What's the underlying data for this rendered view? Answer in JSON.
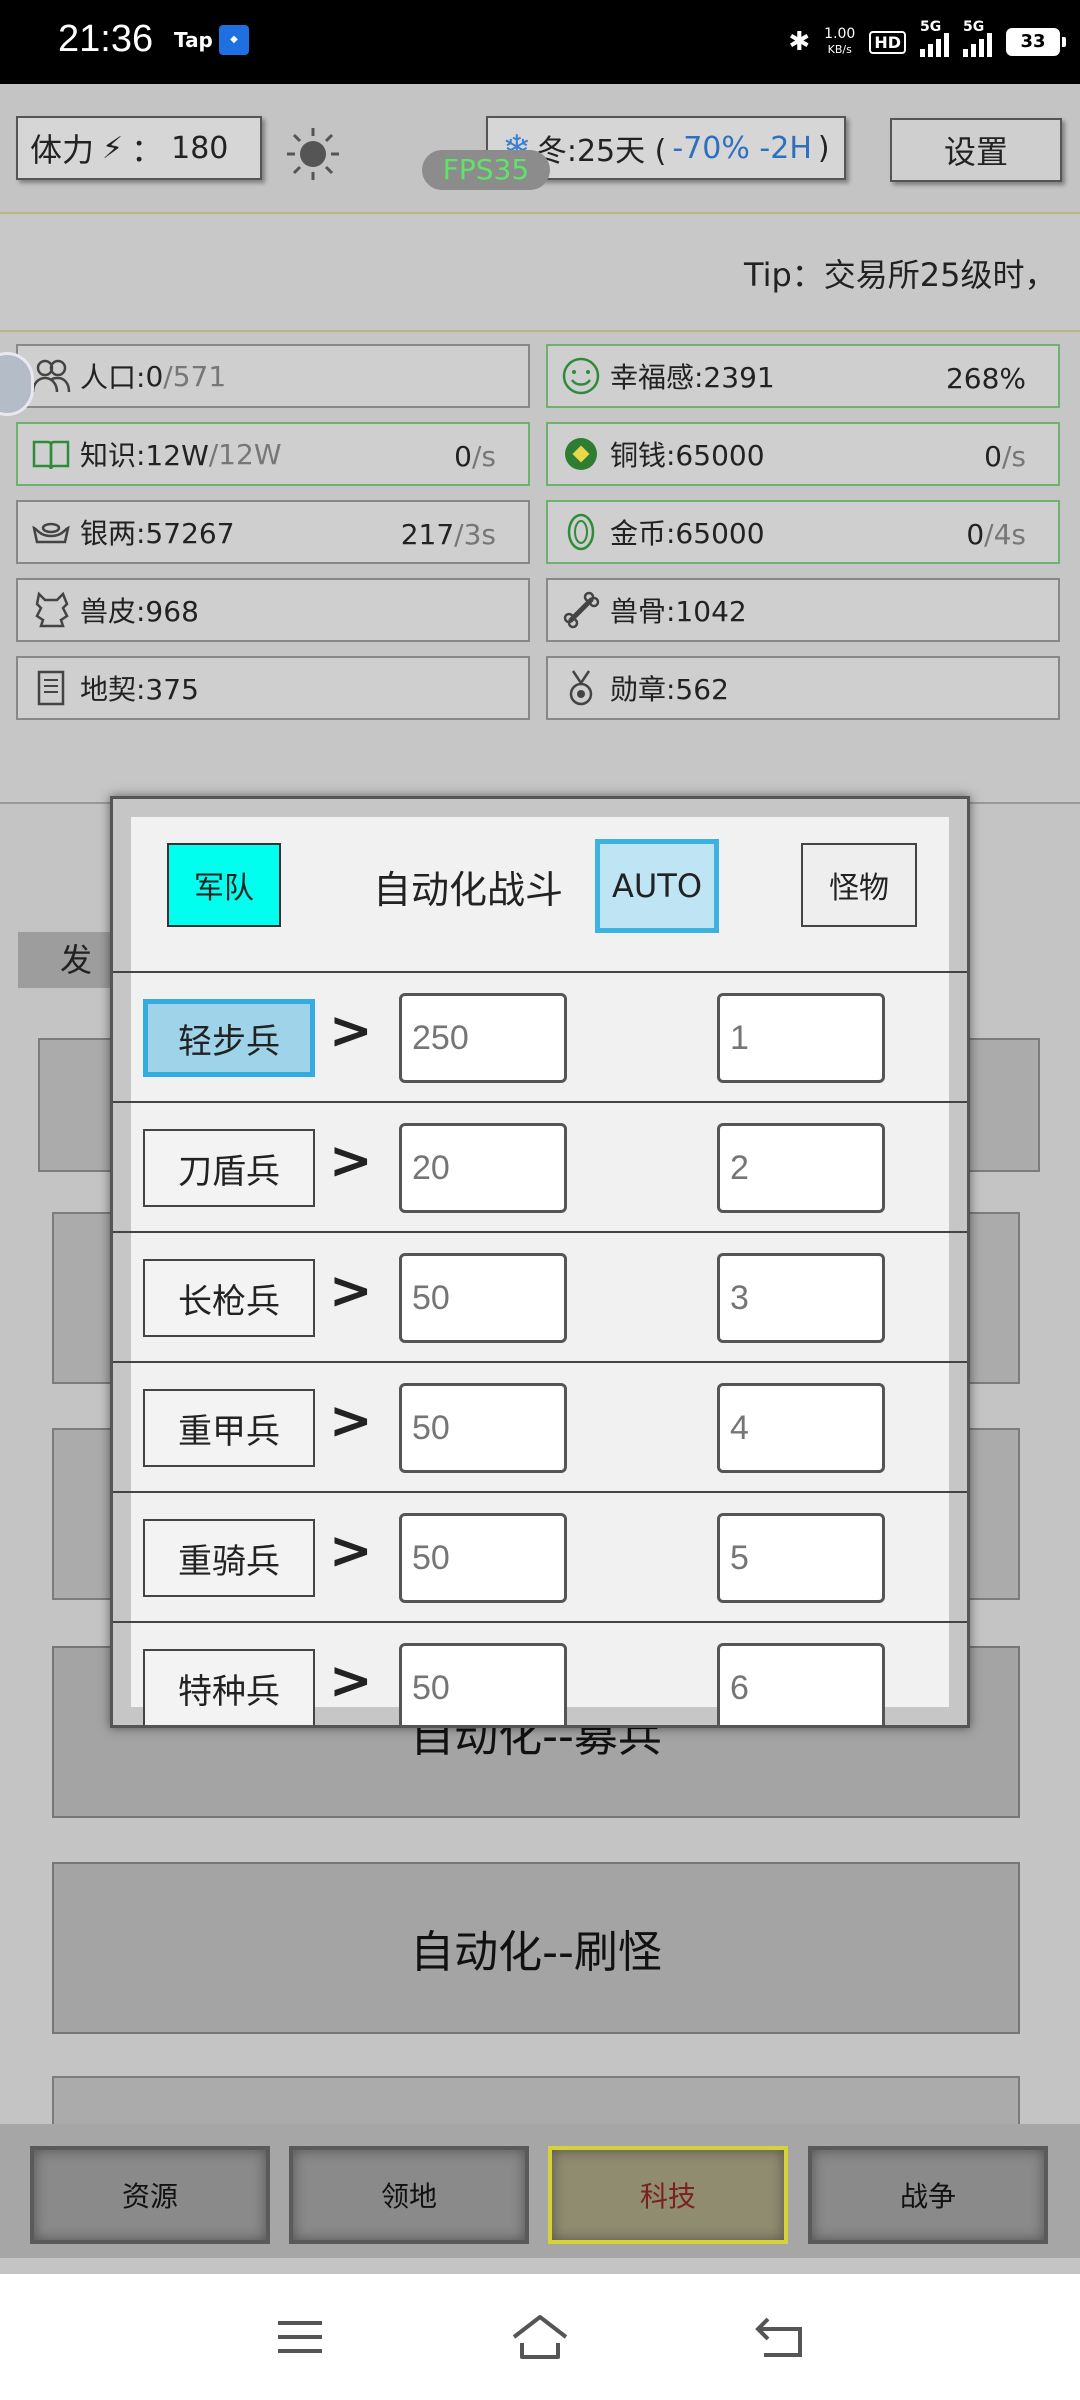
{
  "status_bar": {
    "time": "21:36",
    "tap_label": "Tap",
    "net_speed": "1.00",
    "net_unit": "KB/s",
    "hd_label": "HD",
    "sim1": "1",
    "sim2": "2",
    "net1": "5G",
    "net2": "5G",
    "battery": "33"
  },
  "top": {
    "stamina_label": "体力",
    "stamina_sep": "：",
    "stamina_value": "180",
    "season": "冬:25天 (",
    "season_mods": "-70% -2H",
    "season_close": ")",
    "settings": "设置",
    "fps": "FPS35"
  },
  "tip": "Tip：交易所25级时，",
  "resources": [
    {
      "name": "人口:",
      "value": "0",
      "dim": "/571",
      "rate": "",
      "rate_dim": "",
      "icon": "people-icon",
      "green": false
    },
    {
      "name": "幸福感:2391",
      "value": "",
      "dim": "",
      "rate": "268%",
      "rate_dim": "",
      "icon": "smile-icon",
      "green": true
    },
    {
      "name": "知识:12W",
      "value": "",
      "dim": "/12W",
      "rate": "0",
      "rate_dim": "/s",
      "icon": "book-icon",
      "green": true
    },
    {
      "name": "铜钱:65000",
      "value": "",
      "dim": "",
      "rate": "0",
      "rate_dim": "/s",
      "icon": "coin-icon",
      "green": true
    },
    {
      "name": "银两:57267",
      "value": "",
      "dim": "",
      "rate": "217",
      "rate_dim": "/3s",
      "icon": "silver-icon",
      "green": false
    },
    {
      "name": "金币:65000",
      "value": "",
      "dim": "",
      "rate": "0",
      "rate_dim": "/4s",
      "icon": "gold-icon",
      "green": true
    },
    {
      "name": "兽皮:968",
      "value": "",
      "dim": "",
      "rate": "",
      "rate_dim": "",
      "icon": "hide-icon",
      "green": false
    },
    {
      "name": "兽骨:1042",
      "value": "",
      "dim": "",
      "rate": "",
      "rate_dim": "",
      "icon": "bone-icon",
      "green": false
    },
    {
      "name": "地契:375",
      "value": "",
      "dim": "",
      "rate": "",
      "rate_dim": "",
      "icon": "deed-icon",
      "green": false
    },
    {
      "name": "勋章:562",
      "value": "",
      "dim": "",
      "rate": "",
      "rate_dim": "",
      "icon": "medal-icon",
      "green": false
    }
  ],
  "dev_tab": "发展",
  "big_buttons": [
    "自动化--募兵",
    "自动化--刷怪"
  ],
  "bottom_nav": [
    "资源",
    "领地",
    "科技",
    "战争"
  ],
  "dialog": {
    "army": "军队",
    "title": "自动化战斗",
    "auto": "AUTO",
    "monster": "怪物",
    "rows": [
      {
        "unit": "轻步兵",
        "gt": ">",
        "threshold": "250",
        "priority": "1"
      },
      {
        "unit": "刀盾兵",
        "gt": ">",
        "threshold": "20",
        "priority": "2"
      },
      {
        "unit": "长枪兵",
        "gt": ">",
        "threshold": "50",
        "priority": "3"
      },
      {
        "unit": "重甲兵",
        "gt": ">",
        "threshold": "50",
        "priority": "4"
      },
      {
        "unit": "重骑兵",
        "gt": ">",
        "threshold": "50",
        "priority": "5"
      },
      {
        "unit": "特种兵",
        "gt": ">",
        "threshold": "50",
        "priority": "6"
      }
    ]
  },
  "colors": {
    "army_button": "#00ffee",
    "auto_border": "#3bb2e0",
    "fps_text": "#5fe36a",
    "season_mods": "#2f6fc0",
    "active_nav_border": "#d8d23a"
  }
}
